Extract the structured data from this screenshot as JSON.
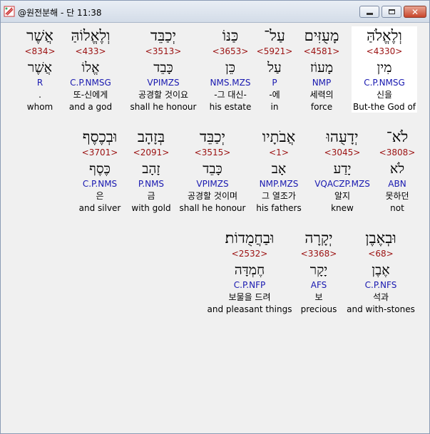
{
  "window": {
    "title": "@원전분해 - 단 11:38",
    "minimize_symbol": "",
    "close_symbol": "✕"
  },
  "rows": [
    [
      {
        "heb": "וְלֶאֱלֹהַּ",
        "num": "<4330>",
        "lex": "מִין",
        "gram": "C.P.NMSG",
        "kor": "신을",
        "eng": "But-the God of",
        "highlight": true
      },
      {
        "heb": "מָעֻזִּים",
        "num": "<4581>",
        "lex": "מָעוֹז",
        "gram": "NMP",
        "kor": "세력의",
        "eng": "force",
        "highlight": false
      },
      {
        "heb": "עַל־",
        "num": "<5921>",
        "lex": "עַל",
        "gram": "P",
        "kor": "-에",
        "eng": "in",
        "highlight": false
      },
      {
        "heb": "כַּנּוֹ",
        "num": "<3653>",
        "lex": "כֵּן",
        "gram": "NMS.MZS",
        "kor": "-그 대신-",
        "eng": "his estate",
        "highlight": false
      },
      {
        "heb": "יְכַבֵּד",
        "num": "<3513>",
        "lex": "כָּבֵד",
        "gram": "VPIMZS",
        "kor": "공경할 것이요",
        "eng": "shall he honour",
        "highlight": false
      },
      {
        "heb": "וְלֶאֱלוֹהַּ",
        "num": "<433>",
        "lex": "אֱלוֹ",
        "gram": "C.P.NMSG",
        "kor": "또-신에게",
        "eng": "and a god",
        "highlight": false
      },
      {
        "heb": "אֲשֶׁר",
        "num": "<834>",
        "lex": "אֲשֶׁר",
        "gram": "R",
        "kor": ".",
        "eng": "whom",
        "highlight": false
      }
    ],
    [
      {
        "heb": "לֹא־",
        "num": "<3808>",
        "lex": "לֹא",
        "gram": "ABN",
        "kor": "못하던",
        "eng": "not",
        "highlight": false
      },
      {
        "heb": "יְדָעֻהוּ",
        "num": "<3045>",
        "lex": "יָדַע",
        "gram": "VQACZP.MZS",
        "kor": "알지",
        "eng": "knew",
        "highlight": false
      },
      {
        "heb": "אֲבֹתָיו",
        "num": "<1>",
        "lex": "אָב",
        "gram": "NMP.MZS",
        "kor": "그 열조가",
        "eng": "his fathers",
        "highlight": false
      },
      {
        "heb": "יְכַבֵּד",
        "num": "<3515>",
        "lex": "כָּבֵד",
        "gram": "VPIMZS",
        "kor": "공경할 것이며",
        "eng": "shall he honour",
        "highlight": false
      },
      {
        "heb": "בְּזָהָב",
        "num": "<2091>",
        "lex": "זָהָב",
        "gram": "P.NMS",
        "kor": "금",
        "eng": "with gold",
        "highlight": false
      },
      {
        "heb": "וּבְכֶסֶף",
        "num": "<3701>",
        "lex": "כֶּסֶף",
        "gram": "C.P.NMS",
        "kor": "은",
        "eng": "and silver",
        "highlight": false
      }
    ],
    [
      {
        "heb": "וּבְאֶבֶן",
        "num": "<68>",
        "lex": "אֶבֶן",
        "gram": "C.P.NFS",
        "kor": "석과",
        "eng": "and with-stones",
        "highlight": false
      },
      {
        "heb": "יְקָרָה",
        "num": "<3368>",
        "lex": "יָקָר",
        "gram": "AFS",
        "kor": "보",
        "eng": "precious",
        "highlight": false
      },
      {
        "heb": "וּבַחֲמֻדוֹת׃",
        "num": "<2532>",
        "lex": "חֶמְדָּה",
        "gram": "C.P.NFP",
        "kor": "보물을 드려",
        "eng": "and pleasant things",
        "highlight": false
      }
    ]
  ]
}
